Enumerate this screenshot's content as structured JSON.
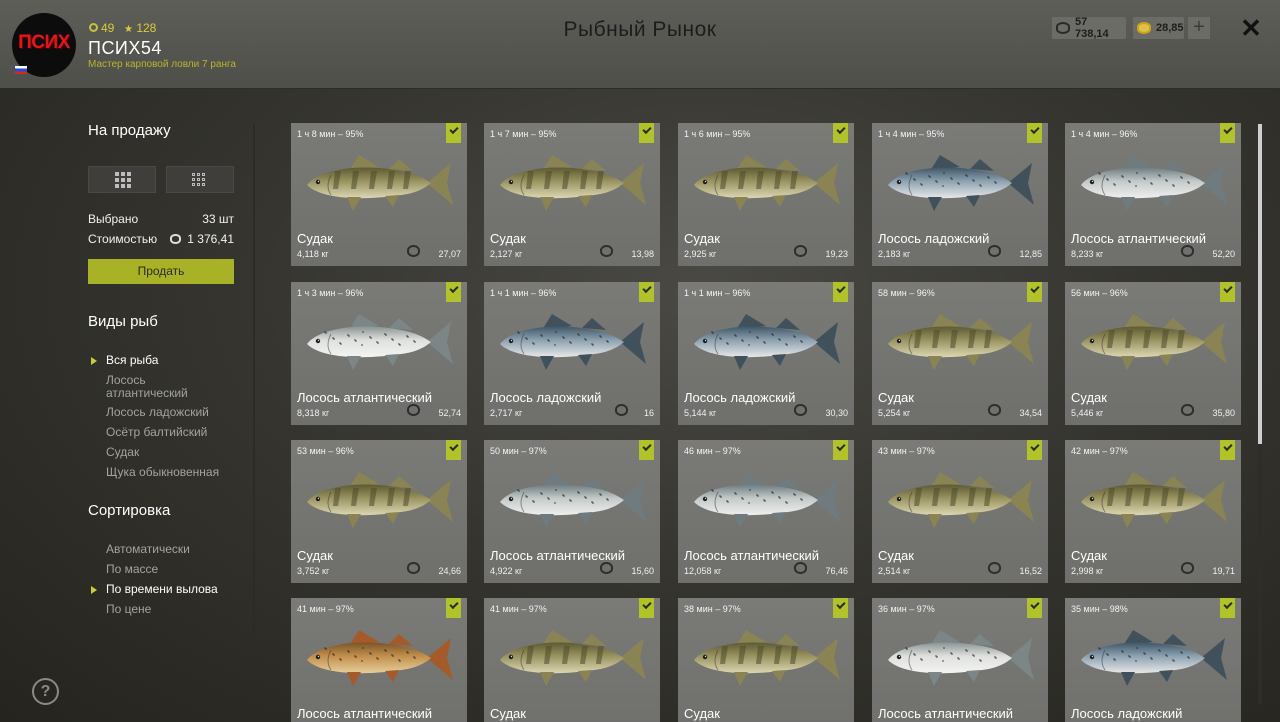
{
  "header": {
    "avatar_text": "ПСИХ",
    "level": "49",
    "stars": "128",
    "nickname": "ПСИХ54",
    "rank": "Мастер карповой ловли 7 ранга",
    "title": "Рыбный Рынок",
    "silver": "57 738,14",
    "gold": "28,85",
    "plus": "+",
    "close": "✕"
  },
  "sidebar": {
    "for_sale_title": "На продажу",
    "selected_label": "Выбрано",
    "selected_value": "33 шт",
    "cost_label": "Стоимостью",
    "cost_value": "1 376,41",
    "sell_button": "Продать",
    "species_title": "Виды рыб",
    "species": [
      "Вся рыба",
      "Лосось атлантический",
      "Лосось ладожский",
      "Осётр балтийский",
      "Судак",
      "Щука обыкновенная"
    ],
    "species_active": 0,
    "sort_title": "Сортировка",
    "sort": [
      "Автоматически",
      "По массе",
      "По времени вылова",
      "По цене"
    ],
    "sort_active": 2,
    "help": "?"
  },
  "cards": [
    {
      "time": "1 ч 8 мин – 95%",
      "name": "Судак",
      "weight": "4,118 кг",
      "price": "27,07",
      "fish": "zander"
    },
    {
      "time": "1 ч 7 мин – 95%",
      "name": "Судак",
      "weight": "2,127 кг",
      "price": "13,98",
      "fish": "zander"
    },
    {
      "time": "1 ч 6 мин – 95%",
      "name": "Судак",
      "weight": "2,925 кг",
      "price": "19,23",
      "fish": "zander"
    },
    {
      "time": "1 ч 4 мин – 95%",
      "name": "Лосось ладожский",
      "weight": "2,183 кг",
      "price": "12,85",
      "fish": "salmon-blue"
    },
    {
      "time": "1 ч 4 мин – 96%",
      "name": "Лосось атлантический",
      "weight": "8,233 кг",
      "price": "52,20",
      "fish": "salmon-silver"
    },
    {
      "time": "1 ч 3 мин – 96%",
      "name": "Лосось атлантический",
      "weight": "8,318 кг",
      "price": "52,74",
      "fish": "salmon-white"
    },
    {
      "time": "1 ч 1 мин – 96%",
      "name": "Лосось ладожский",
      "weight": "2,717 кг",
      "price": "16",
      "fish": "salmon-blue"
    },
    {
      "time": "1 ч 1 мин – 96%",
      "name": "Лосось ладожский",
      "weight": "5,144 кг",
      "price": "30,30",
      "fish": "salmon-blue"
    },
    {
      "time": "58 мин – 96%",
      "name": "Судак",
      "weight": "5,254 кг",
      "price": "34,54",
      "fish": "zander"
    },
    {
      "time": "56 мин – 96%",
      "name": "Судак",
      "weight": "5,446 кг",
      "price": "35,80",
      "fish": "zander"
    },
    {
      "time": "53 мин – 96%",
      "name": "Судак",
      "weight": "3,752 кг",
      "price": "24,66",
      "fish": "zander"
    },
    {
      "time": "50 мин – 97%",
      "name": "Лосось атлантический",
      "weight": "4,922 кг",
      "price": "15,60",
      "fish": "salmon-silver"
    },
    {
      "time": "46 мин – 97%",
      "name": "Лосось атлантический",
      "weight": "12,058 кг",
      "price": "76,46",
      "fish": "salmon-silver"
    },
    {
      "time": "43 мин – 97%",
      "name": "Судак",
      "weight": "2,514 кг",
      "price": "16,52",
      "fish": "zander"
    },
    {
      "time": "42 мин – 97%",
      "name": "Судак",
      "weight": "2,998 кг",
      "price": "19,71",
      "fish": "zander"
    },
    {
      "time": "41 мин – 97%",
      "name": "Лосось атлантический",
      "weight": "",
      "price": "",
      "fish": "trout-brown"
    },
    {
      "time": "41 мин – 97%",
      "name": "Судак",
      "weight": "",
      "price": "",
      "fish": "zander"
    },
    {
      "time": "38 мин – 97%",
      "name": "Судак",
      "weight": "",
      "price": "",
      "fish": "zander"
    },
    {
      "time": "36 мин – 97%",
      "name": "Лосось атлантический",
      "weight": "",
      "price": "",
      "fish": "salmon-white"
    },
    {
      "time": "35 мин – 98%",
      "name": "Лосось ладожский",
      "weight": "",
      "price": "",
      "fish": "salmon-blue"
    }
  ],
  "colors": {
    "accent": "#a8b227",
    "check": "#b2c22a",
    "card": "#767673",
    "zander": "#8f8a56",
    "salmon_blue": "#7f95a6",
    "salmon_silver": "#b7bdbd",
    "salmon_white": "#d9dbd8",
    "trout_brown": "#b98a4a"
  }
}
